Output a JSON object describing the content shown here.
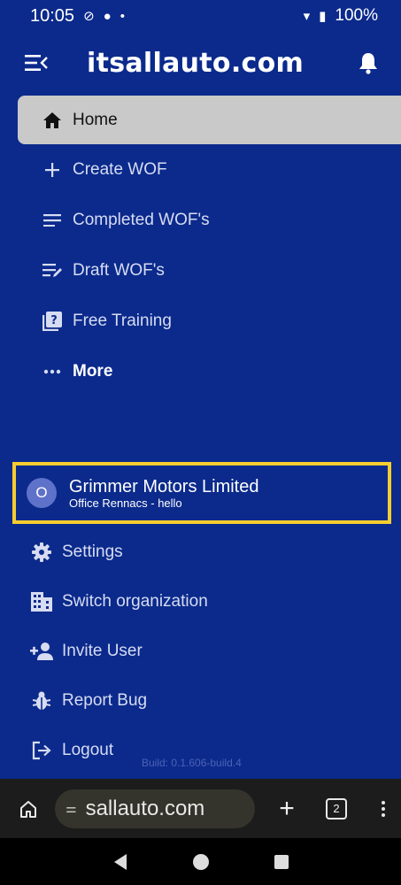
{
  "status_bar": {
    "time": "10:05",
    "battery": "100%"
  },
  "header": {
    "title": "itsallauto.com"
  },
  "nav": {
    "items": [
      {
        "label": "Home",
        "icon": "home-icon"
      },
      {
        "label": "Create WOF",
        "icon": "plus-icon"
      },
      {
        "label": "Completed WOF's",
        "icon": "list-icon"
      },
      {
        "label": "Draft WOF's",
        "icon": "draft-list-icon"
      },
      {
        "label": "Free Training",
        "icon": "help-book-icon"
      },
      {
        "label": "More",
        "icon": "more-dots-icon"
      }
    ]
  },
  "organization": {
    "avatar_letter": "O",
    "name": "Grimmer Motors Limited",
    "subtitle": "Office Rennacs - hello"
  },
  "account_menu": {
    "items": [
      {
        "label": "Settings",
        "icon": "gear-icon"
      },
      {
        "label": "Switch organization",
        "icon": "building-icon"
      },
      {
        "label": "Invite User",
        "icon": "add-user-icon"
      },
      {
        "label": "Report Bug",
        "icon": "bug-icon"
      },
      {
        "label": "Logout",
        "icon": "logout-icon"
      }
    ]
  },
  "build": "Build: 0.1.606-build.4",
  "browser": {
    "url": "sallauto.com",
    "tab_count": "2"
  },
  "colors": {
    "background": "#0b2a8c",
    "highlight_border": "#f7cd2f",
    "active_item": "#c9c9c9"
  }
}
